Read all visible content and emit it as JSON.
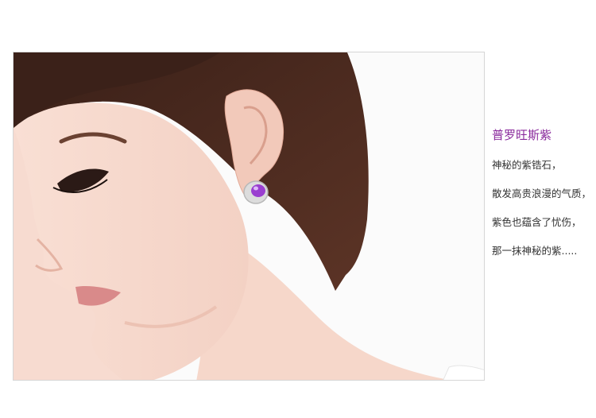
{
  "product": {
    "color_name": "普罗旺斯紫",
    "title_color": "#8a2a9c",
    "gem_color": "#9a3fd0"
  },
  "description": {
    "lines": [
      "神秘的紫锆石，",
      "散发高贵浪漫的气质，",
      "紫色也蕴含了忧伤，",
      "那一抹神秘的紫....."
    ]
  },
  "photo": {
    "subject": "model-wearing-purple-stud-earring"
  }
}
